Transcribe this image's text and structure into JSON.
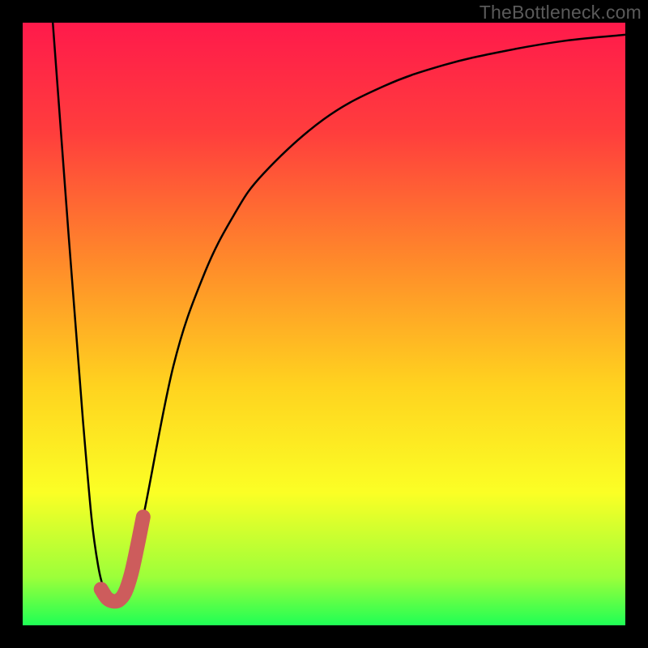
{
  "watermark": "TheBottleneck.com",
  "chart_data": {
    "type": "line",
    "title": "",
    "xlabel": "",
    "ylabel": "",
    "xlim": [
      0,
      100
    ],
    "ylim": [
      0,
      100
    ],
    "series": [
      {
        "name": "bottleneck-curve",
        "x": [
          5,
          10,
          12.5,
          15,
          17.5,
          20,
          25,
          30,
          35,
          40,
          50,
          60,
          70,
          80,
          90,
          100
        ],
        "y": [
          100,
          34,
          10,
          5,
          8,
          18,
          43,
          58,
          68,
          75,
          84,
          89.5,
          93,
          95.3,
          97,
          98
        ]
      }
    ],
    "highlight": {
      "name": "selected-range",
      "x": [
        13,
        14,
        15,
        16,
        17,
        18,
        19,
        20
      ],
      "y": [
        6,
        4.5,
        4,
        4.2,
        5.5,
        8.5,
        13,
        18
      ],
      "color": "#cd5c5c",
      "stroke_width": 18
    },
    "background_gradient": {
      "stops": [
        {
          "offset": 0.0,
          "color": "#ff1a4b"
        },
        {
          "offset": 0.18,
          "color": "#ff3d3d"
        },
        {
          "offset": 0.4,
          "color": "#ff8b2a"
        },
        {
          "offset": 0.6,
          "color": "#ffd21f"
        },
        {
          "offset": 0.78,
          "color": "#fbff25"
        },
        {
          "offset": 0.92,
          "color": "#9cff3a"
        },
        {
          "offset": 1.0,
          "color": "#1fff55"
        }
      ]
    }
  }
}
